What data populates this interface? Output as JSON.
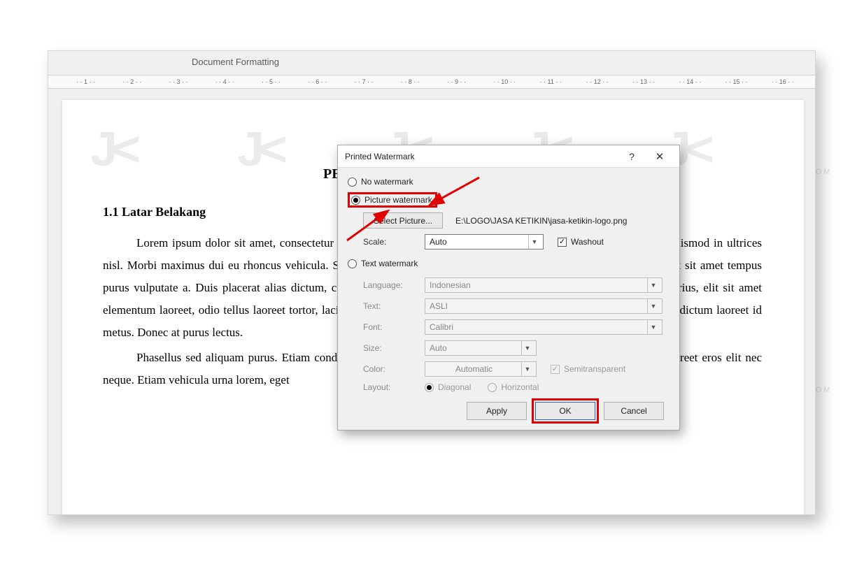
{
  "ribbon": {
    "group_label": "Document Formatting"
  },
  "ruler": {
    "ticks": [
      1,
      2,
      3,
      4,
      5,
      6,
      7,
      8,
      9,
      10,
      11,
      12,
      13,
      14,
      15,
      16
    ]
  },
  "document": {
    "title_fragment": "PEN",
    "section": "1.1  Latar Belakang",
    "para1": "Lorem ipsum dolor sit amet, consectetur adipiscing elit. Ut feugiat lacinia dictum. Phasellus facilisis viverra euismod in ultrices nisl. Morbi maximus dui eu rhoncus vehicula. Sed id ipsum pharetra, sed dictum nulla tristique a. Praesent varius elit sit amet tempus purus vulputate a. Duis placerat alias dictum, consectetur ipsum sit amet vulputate vivamus varius, elit. Vivamus varius, elit sit amet elementum laoreet, odio tellus laoreet tortor, lacinia suscipit magna neque ac odio. Nam eget nulla et sapien vulputate dictum laoreet id metus. Donec at purus lectus.",
    "para2": "Phasellus sed aliquam purus. Etiam condimentum, neque non efficitur euismod, nunc nulla fringilla ante, a laoreet eros elit nec neque. Etiam vehicula urna lorem, eget"
  },
  "dialog": {
    "title": "Printed Watermark",
    "opt_none": "No watermark",
    "opt_picture": "Picture watermark",
    "select_picture_btn": "Select Picture...",
    "picture_path": "E:\\LOGO\\JASA KETIKIN\\jasa-ketikin-logo.png",
    "scale_label": "Scale:",
    "scale_value": "Auto",
    "washout_label": "Washout",
    "opt_text": "Text watermark",
    "language_label": "Language:",
    "language_value": "Indonesian",
    "text_label": "Text:",
    "text_value": "ASLI",
    "font_label": "Font:",
    "font_value": "Calibri",
    "size_label": "Size:",
    "size_value": "Auto",
    "color_label": "Color:",
    "color_value": "Automatic",
    "semi_label": "Semitransparent",
    "layout_label": "Layout:",
    "layout_diag": "Diagonal",
    "layout_horiz": "Horizontal",
    "btn_apply": "Apply",
    "btn_ok": "OK",
    "btn_cancel": "Cancel",
    "help": "?",
    "close": "✕"
  },
  "watermark_brand": "JASA KETIKIN.COM"
}
